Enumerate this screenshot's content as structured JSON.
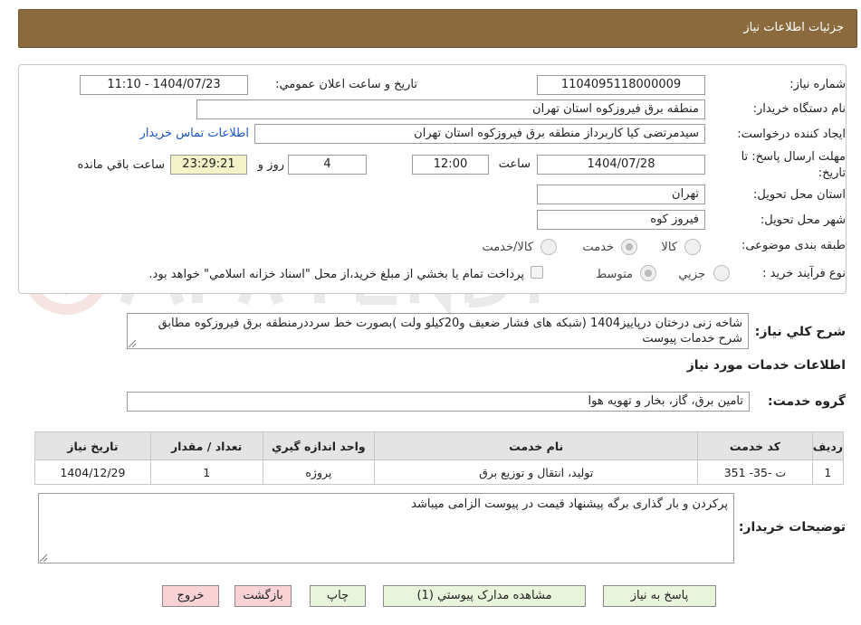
{
  "header": {
    "title": "جزئیات اطلاعات نیاز"
  },
  "form": {
    "need_number_label": "شماره نیاز:",
    "need_number": "1104095118000009",
    "announce_label": "تاریخ و ساعت اعلان عمومي:",
    "announce_value": "1404/07/23 - 11:10",
    "buyer_org_label": "نام دستگاه خريدار:",
    "buyer_org": "منطقه برق فیروزکوه استان تهران",
    "creator_label": "ايجاد کننده درخواست:",
    "creator": "سیدمرتضی کیا کاربرداز منطقه برق فیروزکوه استان تهران",
    "contact_link": "اطلاعات تماس خريدار",
    "deadline_label_1": "مهلت ارسال پاسخ: تا",
    "deadline_label_2": "تاريخ:",
    "deadline_date": "1404/07/28",
    "time_label": "ساعت",
    "deadline_time": "12:00",
    "days_value": "4",
    "days_label": "روز و",
    "remaining_time": "23:29:21",
    "remaining_label": "ساعت باقي مانده",
    "province_label": "استان محل تحويل:",
    "province": "تهران",
    "city_label": "شهر محل تحويل:",
    "city": "فیروز کوه",
    "category_label": "طبقه بندی موضوعی:",
    "category_options": [
      "کالا",
      "خدمت",
      "کالا/خدمت"
    ],
    "category_selected": "خدمت",
    "process_label": "نوع فرآيند خريد :",
    "process_options": [
      "جزيي",
      "متوسط"
    ],
    "process_selected": "متوسط",
    "payment_note": "پرداخت تمام يا بخشي از مبلغ خريد،از محل \"اسناد خزانه اسلامي\" خواهد بود."
  },
  "description": {
    "label": "شرح کلي نياز:",
    "text": "شاخه زنی درختان درپاییز1404 (شبکه های فشار ضعیف و20کیلو ولت )بصورت خط سرددرمنطقه برق فیروزکوه مطابق شرح خدمات پیوست"
  },
  "services": {
    "section_title": "اطلاعات خدمات مورد نياز",
    "group_label": "گروه خدمت:",
    "group_value": "تامين برق، گاز، بخار و تهويه هوا",
    "columns": [
      "رديف",
      "کد خدمت",
      "نام خدمت",
      "واحد اندازه گيري",
      "تعداد / مقدار",
      "تاريخ نياز"
    ],
    "rows": [
      [
        "1",
        "ت -35- 351",
        "توليد، انتقال و توزيع برق",
        "پروژه",
        "1",
        "1404/12/29"
      ]
    ]
  },
  "notes": {
    "label": "توضيحات خريدار:",
    "text": "پرکردن و بار گذاری برگه پیشنهاد قیمت در پیوست الزامی میباشد"
  },
  "buttons": {
    "reply": "پاسخ به نياز",
    "docs": "مشاهده مدارک پيوستي (1)",
    "print": "چاپ",
    "back": "بازگشت",
    "exit": "خروج"
  },
  "colors": {
    "header_bg": "#8b6b3d",
    "link": "#1a55c8",
    "green_button": "#e8f5dc",
    "pink_button": "#f8d2d4",
    "highlight": "#f3f2c8"
  }
}
